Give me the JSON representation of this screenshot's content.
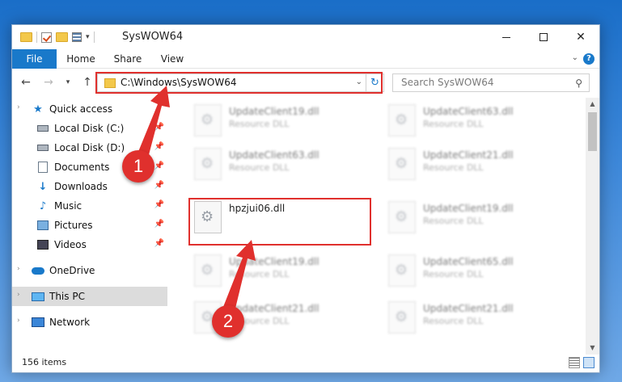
{
  "window": {
    "title": "SysWOW64"
  },
  "ribbon": {
    "tabs": [
      "File",
      "Home",
      "Share",
      "View"
    ],
    "help": "?"
  },
  "address": {
    "path": "C:\\Windows\\SysWOW64",
    "search_placeholder": "Search SysWOW64"
  },
  "sidebar": {
    "items": [
      {
        "label": "Quick access",
        "icon": "star-icon",
        "pinned": false
      },
      {
        "label": "Local Disk (C:)",
        "icon": "drive-icon",
        "pinned": true
      },
      {
        "label": "Local Disk (D:)",
        "icon": "drive-icon",
        "pinned": true
      },
      {
        "label": "Documents",
        "icon": "documents-icon",
        "pinned": true
      },
      {
        "label": "Downloads",
        "icon": "download-icon",
        "pinned": true
      },
      {
        "label": "Music",
        "icon": "music-icon",
        "pinned": true
      },
      {
        "label": "Pictures",
        "icon": "pictures-icon",
        "pinned": true
      },
      {
        "label": "Videos",
        "icon": "videos-icon",
        "pinned": true
      },
      {
        "label": "OneDrive",
        "icon": "cloud-icon",
        "pinned": false
      },
      {
        "label": "This PC",
        "icon": "computer-icon",
        "pinned": false
      },
      {
        "label": "Network",
        "icon": "network-icon",
        "pinned": false
      }
    ],
    "selected": "This PC"
  },
  "files": [
    {
      "name": "UpdateClient19.dll",
      "type": "Resource DLL",
      "blurred": true
    },
    {
      "name": "UpdateClient63.dll",
      "type": "Resource DLL",
      "blurred": true
    },
    {
      "name": "UpdateClient63.dll",
      "type": "Resource DLL",
      "blurred": true
    },
    {
      "name": "UpdateClient21.dll",
      "type": "Resource DLL",
      "blurred": true
    },
    {
      "name": "hpzjui06.dll",
      "type": "",
      "blurred": false
    },
    {
      "name": "UpdateClient19.dll",
      "type": "Resource DLL",
      "blurred": true
    },
    {
      "name": "UpdateClient19.dll",
      "type": "Resource DLL",
      "blurred": true
    },
    {
      "name": "UpdateClient65.dll",
      "type": "Resource DLL",
      "blurred": true
    },
    {
      "name": "UpdateClient21.dll",
      "type": "Resource DLL",
      "blurred": true
    },
    {
      "name": "UpdateClient21.dll",
      "type": "Resource DLL",
      "blurred": true
    }
  ],
  "status": {
    "item_count": "156 items"
  },
  "annotations": {
    "step1": "1",
    "step2": "2",
    "color": "#e0302d"
  }
}
